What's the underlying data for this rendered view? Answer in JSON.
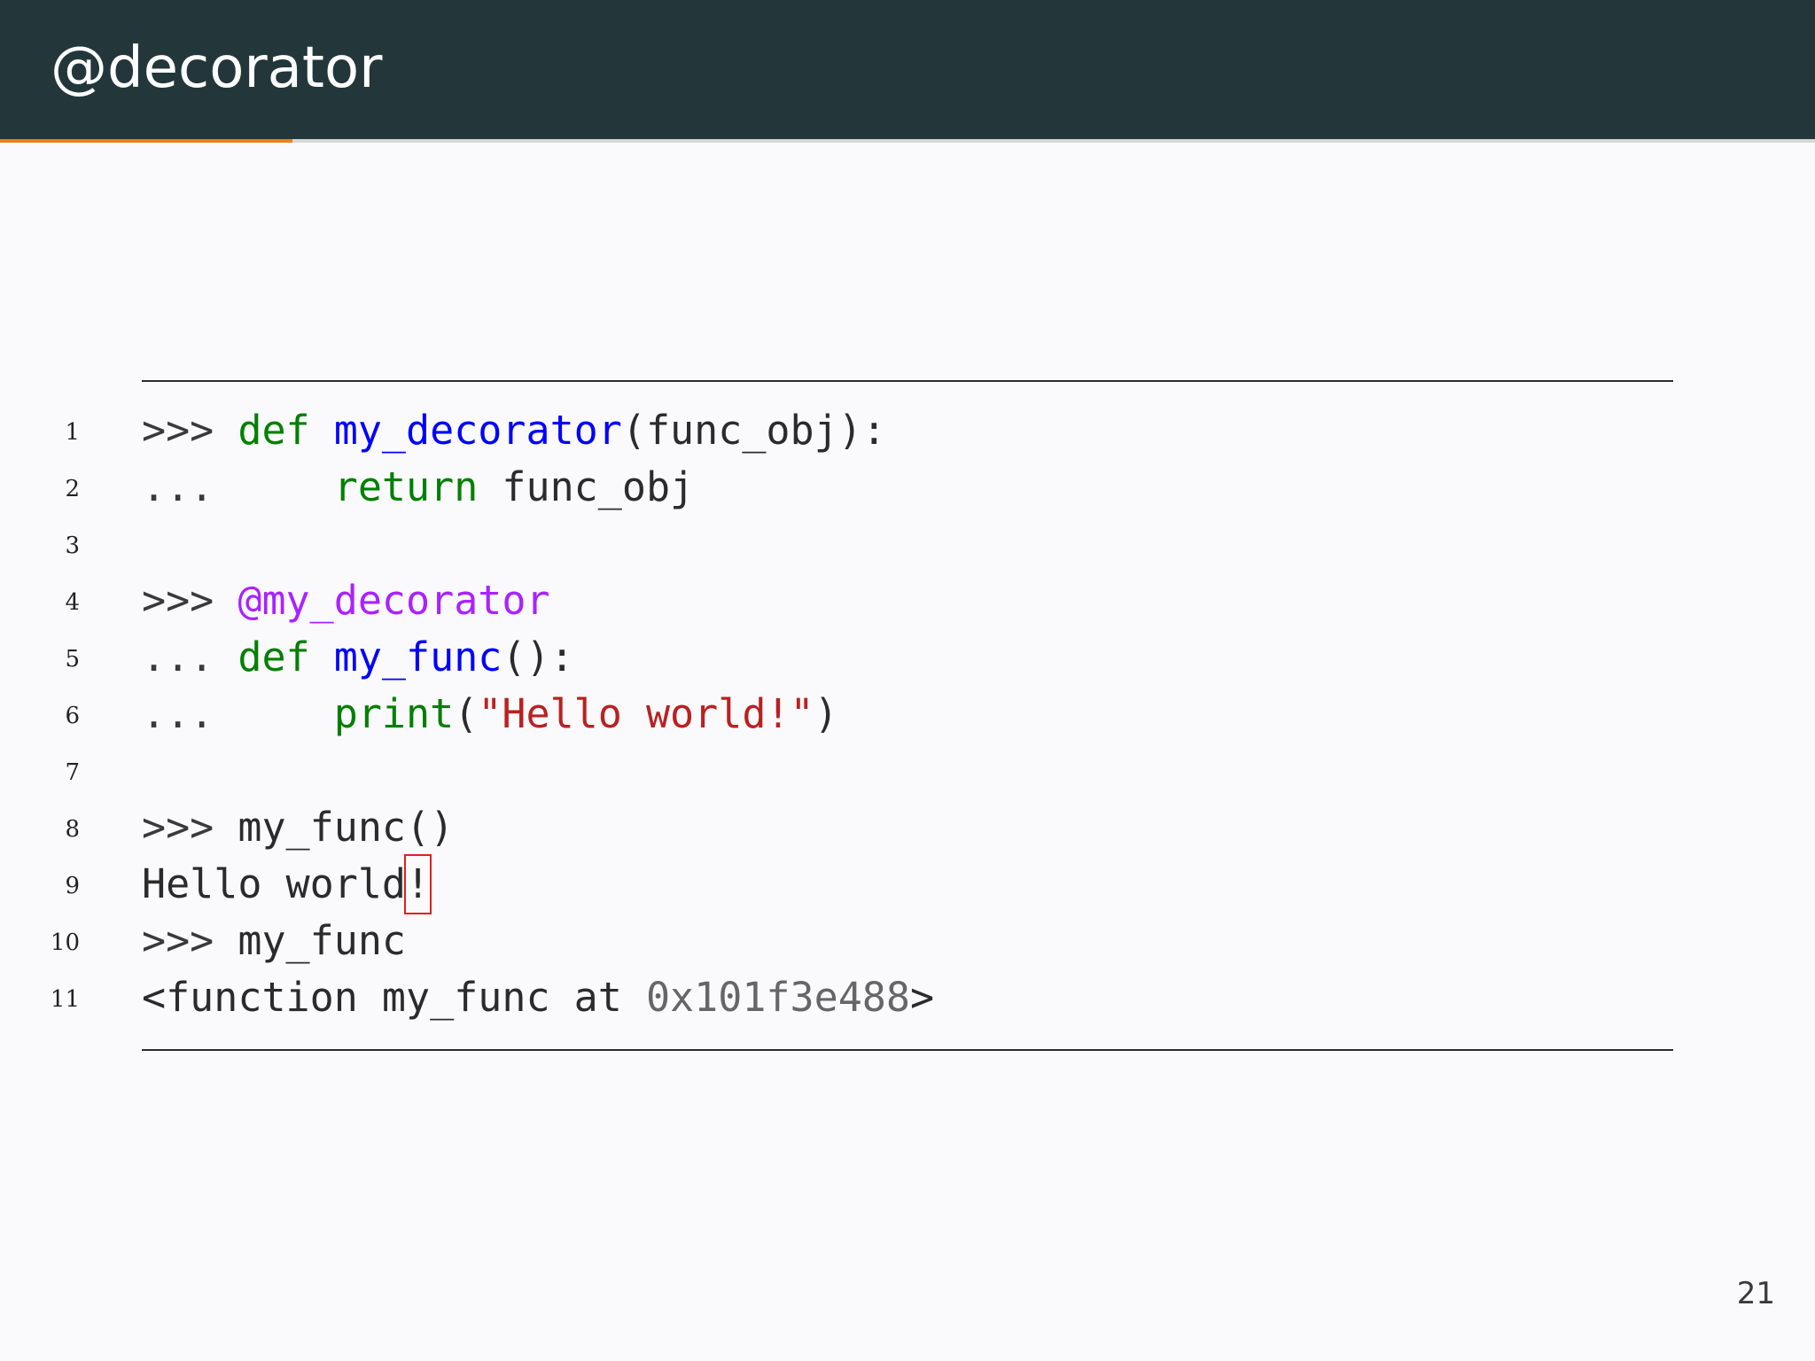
{
  "slide": {
    "title": "@decorator",
    "page_number": "21",
    "progress_fraction": 0.161
  },
  "colors": {
    "title_bar": "#23373b",
    "progress": "#eb811b",
    "background": "#fafafd",
    "keyword": "#008000",
    "function_name": "#0000ff",
    "decorator": "#aa22ff",
    "string": "#ba2121",
    "highlight_box": "#e02020"
  },
  "code": {
    "language": "python",
    "lines": [
      {
        "number": "1",
        "tokens": [
          {
            "text": ">>> ",
            "type": "prompt"
          },
          {
            "text": "def",
            "type": "kw"
          },
          {
            "text": " ",
            "type": "text"
          },
          {
            "text": "my_decorator",
            "type": "fn"
          },
          {
            "text": "(func_obj):",
            "type": "text"
          }
        ]
      },
      {
        "number": "2",
        "tokens": [
          {
            "text": "...     ",
            "type": "prompt"
          },
          {
            "text": "return",
            "type": "kw"
          },
          {
            "text": " func_obj",
            "type": "text"
          }
        ]
      },
      {
        "number": "3",
        "tokens": []
      },
      {
        "number": "4",
        "tokens": [
          {
            "text": ">>> ",
            "type": "prompt"
          },
          {
            "text": "@my_decorator",
            "type": "dec"
          }
        ]
      },
      {
        "number": "5",
        "tokens": [
          {
            "text": "... ",
            "type": "prompt"
          },
          {
            "text": "def",
            "type": "kw"
          },
          {
            "text": " ",
            "type": "text"
          },
          {
            "text": "my_func",
            "type": "fn"
          },
          {
            "text": "():",
            "type": "text"
          }
        ]
      },
      {
        "number": "6",
        "tokens": [
          {
            "text": "...     ",
            "type": "prompt"
          },
          {
            "text": "print",
            "type": "kw"
          },
          {
            "text": "(",
            "type": "text"
          },
          {
            "text": "\"Hello world!\"",
            "type": "str"
          },
          {
            "text": ")",
            "type": "text"
          }
        ]
      },
      {
        "number": "7",
        "tokens": []
      },
      {
        "number": "8",
        "tokens": [
          {
            "text": ">>> ",
            "type": "prompt"
          },
          {
            "text": "my_func()",
            "type": "text"
          }
        ]
      },
      {
        "number": "9",
        "tokens": [
          {
            "text": "Hello world",
            "type": "text"
          },
          {
            "text": "!",
            "type": "text",
            "boxed": true
          }
        ]
      },
      {
        "number": "10",
        "tokens": [
          {
            "text": ">>> ",
            "type": "prompt"
          },
          {
            "text": "my_func",
            "type": "text"
          }
        ]
      },
      {
        "number": "11",
        "tokens": [
          {
            "text": "<function my_func at ",
            "type": "text"
          },
          {
            "text": "0x101f3e488",
            "type": "num"
          },
          {
            "text": ">",
            "type": "text"
          }
        ]
      }
    ]
  }
}
